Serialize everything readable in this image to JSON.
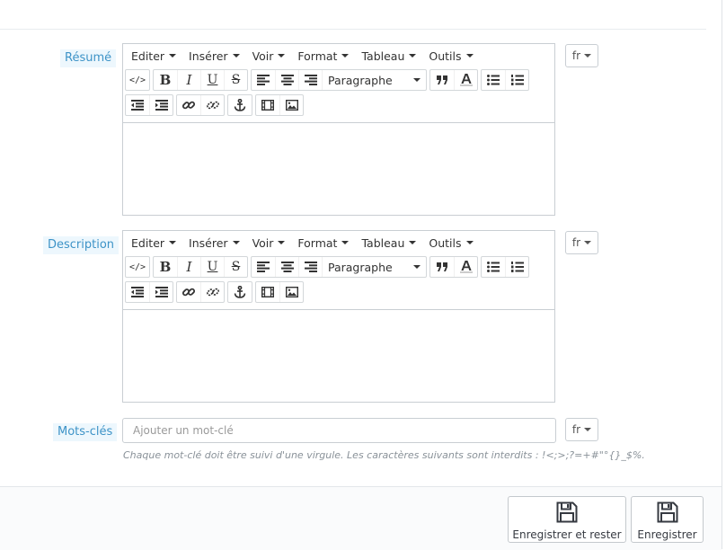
{
  "fields": {
    "resume": {
      "label": "Résumé",
      "menu": [
        "Editer",
        "Insérer",
        "Voir",
        "Format",
        "Tableau",
        "Outils"
      ],
      "format_value": "Paragraphe",
      "lang": "fr"
    },
    "description": {
      "label": "Description",
      "menu": [
        "Editer",
        "Insérer",
        "Voir",
        "Format",
        "Tableau",
        "Outils"
      ],
      "format_value": "Paragraphe",
      "lang": "fr"
    },
    "keywords": {
      "label": "Mots-clés",
      "placeholder": "Ajouter un mot-clé",
      "lang": "fr",
      "help": "Chaque mot-clé doit être suivi d'une virgule. Les caractères suivants sont interdits : !<;>;?=+#\"°{}_$%."
    }
  },
  "icons": {
    "toolbar": [
      "code-icon",
      "bold-icon",
      "italic-icon",
      "underline-icon",
      "strikethrough-icon",
      "align-left-icon",
      "align-center-icon",
      "align-right-icon",
      "blockquote-icon",
      "text-color-icon",
      "bullet-list-icon",
      "numbered-list-icon",
      "outdent-icon",
      "indent-icon",
      "link-icon",
      "unlink-icon",
      "anchor-icon",
      "media-icon",
      "image-icon"
    ],
    "save": "floppy-disk-icon"
  },
  "footer": {
    "save_and_stay": "Enregistrer et rester",
    "save": "Enregistrer"
  },
  "colors": {
    "label_bg": "#edf7fd",
    "label_text": "#3d93c7",
    "border": "#c9ced3"
  }
}
